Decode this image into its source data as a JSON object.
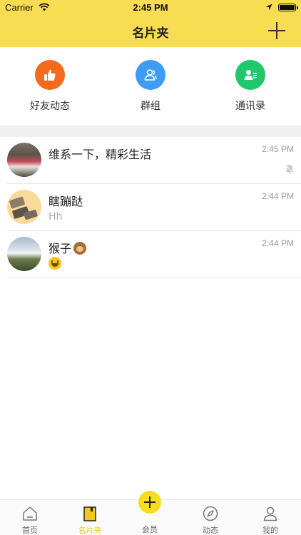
{
  "status": {
    "carrier": "Carrier",
    "time": "2:45 PM"
  },
  "header": {
    "title": "名片夹"
  },
  "quick": [
    {
      "label": "好友动态",
      "icon": "thumbs-up-icon",
      "color": "#f46a1e"
    },
    {
      "label": "群组",
      "icon": "group-icon",
      "color": "#3e9cf4"
    },
    {
      "label": "通讯录",
      "icon": "contacts-icon",
      "color": "#1fc86a"
    }
  ],
  "conversations": [
    {
      "name": "维系一下，精彩生活",
      "preview": "",
      "time": "2:45 PM",
      "muted": true
    },
    {
      "name": "瞎蹦跶",
      "preview": "Hh",
      "time": "2:44 PM",
      "muted": false
    },
    {
      "name": "猴子",
      "name_emoji": "monkey",
      "preview_emoji": "smiley",
      "time": "2:44 PM",
      "muted": false
    }
  ],
  "tabs": [
    {
      "label": "首页",
      "icon": "home-icon"
    },
    {
      "label": "名片夹",
      "icon": "card-holder-icon",
      "active": true
    },
    {
      "label": "会员",
      "icon": "plus-icon"
    },
    {
      "label": "动态",
      "icon": "compass-icon"
    },
    {
      "label": "我的",
      "icon": "profile-icon"
    }
  ],
  "colors": {
    "accent": "#f8dc52",
    "tab_active": "#f0c81e"
  }
}
